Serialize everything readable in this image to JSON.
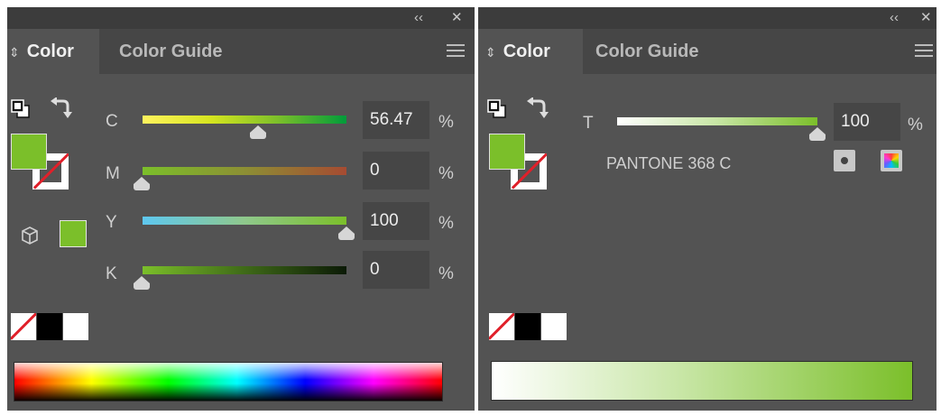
{
  "colors": {
    "panel_bg": "#535353",
    "fill": "#7bbf2a",
    "accent_green": "#7bbf2a"
  },
  "left_panel": {
    "collapse_icon": "double-chevron-left-icon",
    "close_icon": "close-icon",
    "collapse_label": "‹‹",
    "close_label": "✕",
    "tabs": [
      {
        "label": "Color",
        "active": true
      },
      {
        "label": "Color Guide",
        "active": false
      }
    ],
    "channels": [
      {
        "label": "C",
        "value": "56.47",
        "unit": "%",
        "level": 0.5647
      },
      {
        "label": "M",
        "value": "0",
        "unit": "%",
        "level": 0
      },
      {
        "label": "Y",
        "value": "100",
        "unit": "%",
        "level": 1.0
      },
      {
        "label": "K",
        "value": "0",
        "unit": "%",
        "level": 0
      }
    ]
  },
  "right_panel": {
    "collapse_label": "‹‹",
    "close_label": "✕",
    "tabs": [
      {
        "label": "Color",
        "active": true
      },
      {
        "label": "Color Guide",
        "active": false
      }
    ],
    "tint": {
      "label": "T",
      "value": "100",
      "unit": "%",
      "level": 1.0
    },
    "swatch_name": "PANTONE 368 C"
  }
}
